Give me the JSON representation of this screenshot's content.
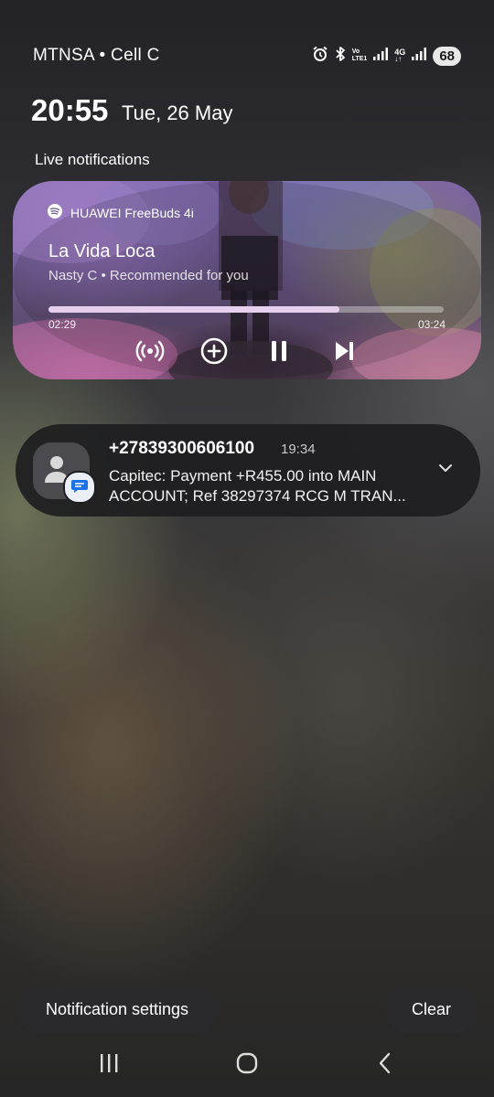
{
  "status_bar": {
    "carrier": "MTNSA • Cell C",
    "volte_top": "Vo",
    "volte_bottom": "LTE1",
    "network_top": "4G",
    "battery": "68"
  },
  "header": {
    "time": "20:55",
    "date": "Tue, 26 May"
  },
  "live_notifications": {
    "title": "Live notifications",
    "media": {
      "output_device": "HUAWEI FreeBuds 4i",
      "track_title": "La Vida Loca",
      "subtitle": "Nasty C • Recommended for you",
      "elapsed": "02:29",
      "total": "03:24",
      "progress_fraction": 0.735
    }
  },
  "message_notification": {
    "sender": "+27839300606100",
    "time": "19:34",
    "text": "Capitec: Payment +R455.00 into MAIN ACCOUNT; Ref 38297374 RCG M TRAN..."
  },
  "footer": {
    "settings_label": "Notification settings",
    "clear_label": "Clear"
  },
  "icons": {
    "app": "spotify-icon",
    "cast": "broadcast-icon",
    "add": "add-circle-icon",
    "pause": "pause-icon",
    "next": "skip-next-icon",
    "expand": "chevron-down-icon",
    "nav": [
      "recents-icon",
      "home-icon",
      "back-icon"
    ]
  },
  "colors": {
    "progress_fill": "#e7cfee",
    "card_dark": "#1e1e20",
    "message_badge": "#1a73e8"
  }
}
